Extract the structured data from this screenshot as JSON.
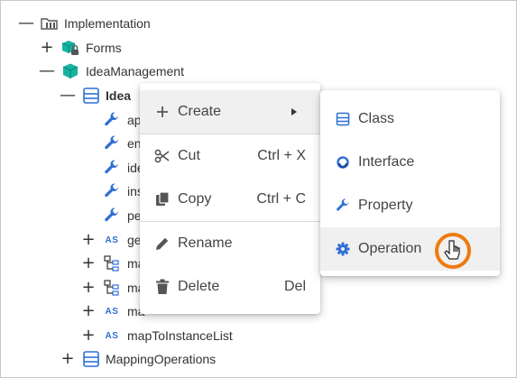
{
  "tree": {
    "root": {
      "label": "Implementation",
      "toggle": "—",
      "icon": "folder-icon"
    },
    "forms": {
      "label": "Forms",
      "toggle": "+",
      "icon": "locked-package-icon"
    },
    "idea_management": {
      "label": "IdeaManagement",
      "toggle": "—",
      "icon": "package-icon"
    },
    "idea": {
      "label": "Idea",
      "toggle": "—",
      "icon": "class-icon"
    },
    "props": [
      {
        "label": "ap",
        "icon": "wrench-icon"
      },
      {
        "label": "en",
        "icon": "wrench-icon"
      },
      {
        "label": "ide",
        "icon": "wrench-icon"
      },
      {
        "label": "ins",
        "icon": "wrench-icon"
      },
      {
        "label": "pe",
        "icon": "wrench-icon"
      }
    ],
    "ops": [
      {
        "label": "ge",
        "toggle": "+",
        "icon": "as-badge",
        "badge": "AS"
      },
      {
        "label": "ma",
        "toggle": "+",
        "icon": "hierarchy-icon"
      },
      {
        "label": "ma",
        "toggle": "+",
        "icon": "hierarchy-icon"
      },
      {
        "label": "ma",
        "toggle": "+",
        "icon": "as-badge",
        "badge": "AS"
      },
      {
        "label": "mapToInstanceList",
        "toggle": "+",
        "icon": "as-badge",
        "badge": "AS"
      }
    ],
    "mapping_operations": {
      "label": "MappingOperations",
      "toggle": "+",
      "icon": "class-icon"
    }
  },
  "context_menu": {
    "items": [
      {
        "label": "Create",
        "icon": "plus-icon",
        "shortcut": "",
        "submenu": true
      },
      {
        "label": "Cut",
        "icon": "scissors-icon",
        "shortcut": "Ctrl + X"
      },
      {
        "label": "Copy",
        "icon": "copy-icon",
        "shortcut": "Ctrl + C"
      },
      {
        "label": "Rename",
        "icon": "pencil-icon",
        "shortcut": ""
      },
      {
        "label": "Delete",
        "icon": "trash-icon",
        "shortcut": "Del"
      }
    ]
  },
  "submenu": {
    "items": [
      {
        "label": "Class",
        "icon": "class-icon"
      },
      {
        "label": "Interface",
        "icon": "interface-icon"
      },
      {
        "label": "Property",
        "icon": "wrench-icon"
      },
      {
        "label": "Operation",
        "icon": "gear-icon",
        "hovered": true
      }
    ]
  },
  "colors": {
    "accent_blue": "#2f6fd6",
    "package_green": "#17b3a3",
    "hover_bg": "#f0f0f0",
    "cursor_ring": "#f07a10"
  }
}
